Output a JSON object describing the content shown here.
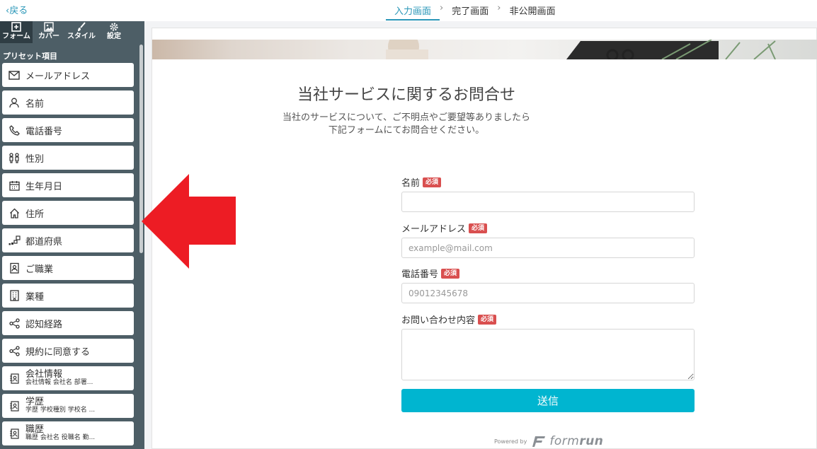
{
  "topbar": {
    "back_label": "戻る",
    "steps": [
      "入力画面",
      "完了画面",
      "非公開画面"
    ],
    "active_step": 0,
    "accent_color": "#2a97b8"
  },
  "sidebar": {
    "tabs": [
      {
        "label": "フォーム",
        "icon": "plus-square-icon",
        "active": true
      },
      {
        "label": "カバー",
        "icon": "image-icon",
        "active": false
      },
      {
        "label": "スタイル",
        "icon": "brush-icon",
        "active": false
      },
      {
        "label": "設定",
        "icon": "gear-icon",
        "active": false
      }
    ],
    "preset_title": "プリセット項目",
    "presets": [
      {
        "label": "メールアドレス",
        "icon": "mail-icon"
      },
      {
        "label": "名前",
        "icon": "person-icon"
      },
      {
        "label": "電話番号",
        "icon": "phone-icon"
      },
      {
        "label": "性別",
        "icon": "gender-icon"
      },
      {
        "label": "生年月日",
        "icon": "calendar-icon"
      },
      {
        "label": "住所",
        "icon": "home-icon"
      },
      {
        "label": "都道府県",
        "icon": "map-blocks-icon"
      },
      {
        "label": "ご職業",
        "icon": "id-badge-icon"
      },
      {
        "label": "業種",
        "icon": "building-icon"
      },
      {
        "label": "認知経路",
        "icon": "share-icon"
      },
      {
        "label": "規約に同意する",
        "icon": "share-icon"
      },
      {
        "label": "会社情報",
        "sub": "会社情報 会社名 部署...",
        "icon": "contact-card-icon"
      },
      {
        "label": "学歴",
        "sub": "学歴 学校種別 学校名 ...",
        "icon": "contact-card-icon"
      },
      {
        "label": "職歴",
        "sub": "職歴 会社名 役職名 勤...",
        "icon": "contact-card-icon"
      }
    ],
    "background_color": "#4d5e66"
  },
  "form": {
    "title": "当社サービスに関するお問合せ",
    "description_line1": "当社のサービスについて、ご不明点やご要望等ありましたら",
    "description_line2": "下記フォームにてお問合せください。",
    "required_badge": "必須",
    "fields": {
      "name": {
        "label": "名前",
        "value": "",
        "placeholder": ""
      },
      "email": {
        "label": "メールアドレス",
        "value": "",
        "placeholder": "example@mail.com"
      },
      "phone": {
        "label": "電話番号",
        "value": "",
        "placeholder": "09012345678"
      },
      "message": {
        "label": "お問い合わせ内容",
        "value": ""
      }
    },
    "submit_label": "送信",
    "submit_color": "#00b5d0",
    "powered_by": "Powered by",
    "brand_name_light": "form",
    "brand_name_bold": "run"
  },
  "annotation": {
    "arrow_color": "#ed1c24",
    "direction": "left"
  }
}
